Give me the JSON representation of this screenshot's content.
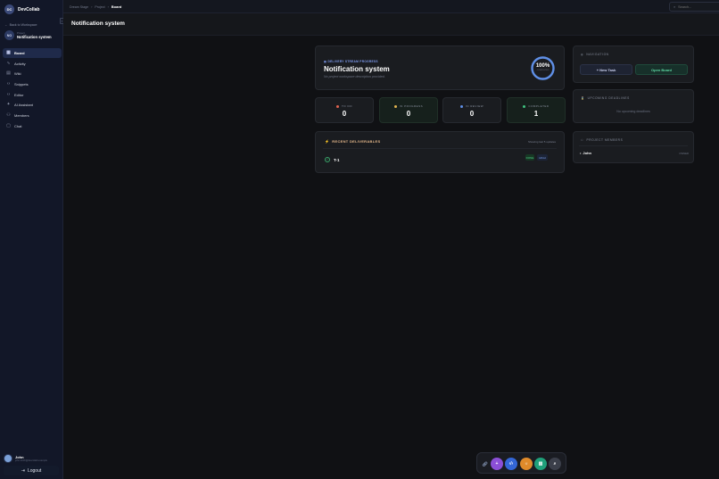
{
  "sidebar": {
    "brand": {
      "logo": "DC",
      "name": "DevCollab"
    },
    "back_label": "Back to Workspace",
    "project": {
      "avatar": "NO",
      "sub": "Project",
      "name": "Notification system"
    },
    "items": [
      {
        "label": "Board",
        "icon": "board-icon",
        "glyph": "▦",
        "active": true
      },
      {
        "label": "Activity",
        "icon": "activity-icon",
        "glyph": "∿",
        "active": false
      },
      {
        "label": "Wiki",
        "icon": "book-icon",
        "glyph": "▤",
        "active": false
      },
      {
        "label": "Snippets",
        "icon": "code-icon",
        "glyph": "‹›",
        "active": false
      },
      {
        "label": "Editor",
        "icon": "editor-icon",
        "glyph": "‹›",
        "active": false
      },
      {
        "label": "AI Assistant",
        "icon": "sparkle-icon",
        "glyph": "✦",
        "active": false
      },
      {
        "label": "Members",
        "icon": "users-icon",
        "glyph": "⚇",
        "active": false
      },
      {
        "label": "Chat",
        "icon": "chat-icon",
        "glyph": "▢",
        "active": false
      }
    ],
    "user": {
      "name": "John",
      "email": "john.smith@devcollab.example"
    },
    "logout_label": "Logout"
  },
  "topbar": {
    "breadcrumb": [
      "Dream Stage",
      "Project",
      "Board"
    ],
    "search_placeholder": "Search..."
  },
  "header": {
    "title": "Notification system"
  },
  "hero": {
    "label": "DELIVERY STREAM PROGRESS",
    "title": "Notification system",
    "description": "No project workspace description provided.",
    "progress_pct": 100,
    "progress_label": "100%",
    "progress_sub": "COMPLETED"
  },
  "stats": {
    "todo": {
      "label": "TO DO",
      "value": "0",
      "color": "#e0624f"
    },
    "in_progress": {
      "label": "IN PROGRESS",
      "value": "0",
      "color": "#e0b34f"
    },
    "in_review": {
      "label": "IN REVIEW",
      "value": "0",
      "color": "#5f8fe6"
    },
    "completed": {
      "label": "COMPLETED",
      "value": "1",
      "color": "#3fc27f"
    }
  },
  "recent": {
    "title": "RECENT DELIVERABLES",
    "note": "Showing last 5 updates",
    "items": [
      {
        "name": "T-1",
        "status": "DONE",
        "priority": "HIGH"
      }
    ]
  },
  "navigation": {
    "title": "NAVIGATION",
    "new_task_label": "+ New Task",
    "open_board_label": "Open Board"
  },
  "deadlines": {
    "title": "UPCOMING DEADLINES",
    "empty": "No upcoming deadlines"
  },
  "members": {
    "title": "PROJECT MEMBERS",
    "items": [
      {
        "name": "John",
        "role": "OWNER"
      }
    ]
  },
  "colors": {
    "accent": "#7f9cf0",
    "success": "#3fc27f",
    "ring": "#5f8fe6"
  }
}
